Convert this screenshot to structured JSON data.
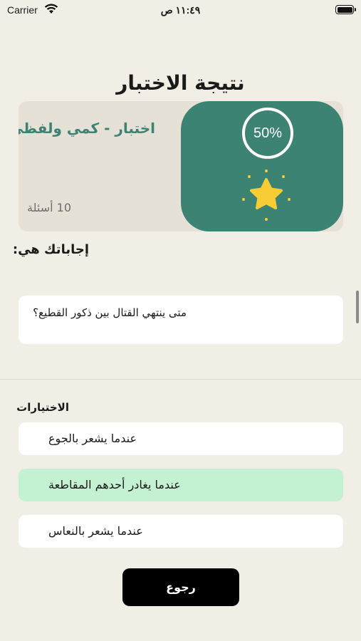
{
  "status_bar": {
    "carrier": "Carrier",
    "time": "١١:٤٩ ص"
  },
  "page": {
    "title": "نتيجة الاختبار"
  },
  "result_card": {
    "quiz_name": "اختبار - كمي ولفظي",
    "question_count": "10 أسئلة",
    "score": "50%",
    "icon": "star-icon",
    "colors": {
      "panel": "#3d8373",
      "star": "#f7cc35"
    }
  },
  "answers": {
    "label": "إجاباتك هي:",
    "question": "متى ينتهي القتال بين ذكور القطيع؟"
  },
  "choices": {
    "label": "الاختيارات",
    "items": [
      {
        "text": "عندما يشعر بالجوع",
        "selected": false
      },
      {
        "text": "عندما يغادر أحدهم المقاطعة",
        "selected": true
      },
      {
        "text": "عندما يشعر بالنعاس",
        "selected": false
      }
    ],
    "selected_color": "#c3f1d2"
  },
  "actions": {
    "back_label": "رجوع"
  }
}
